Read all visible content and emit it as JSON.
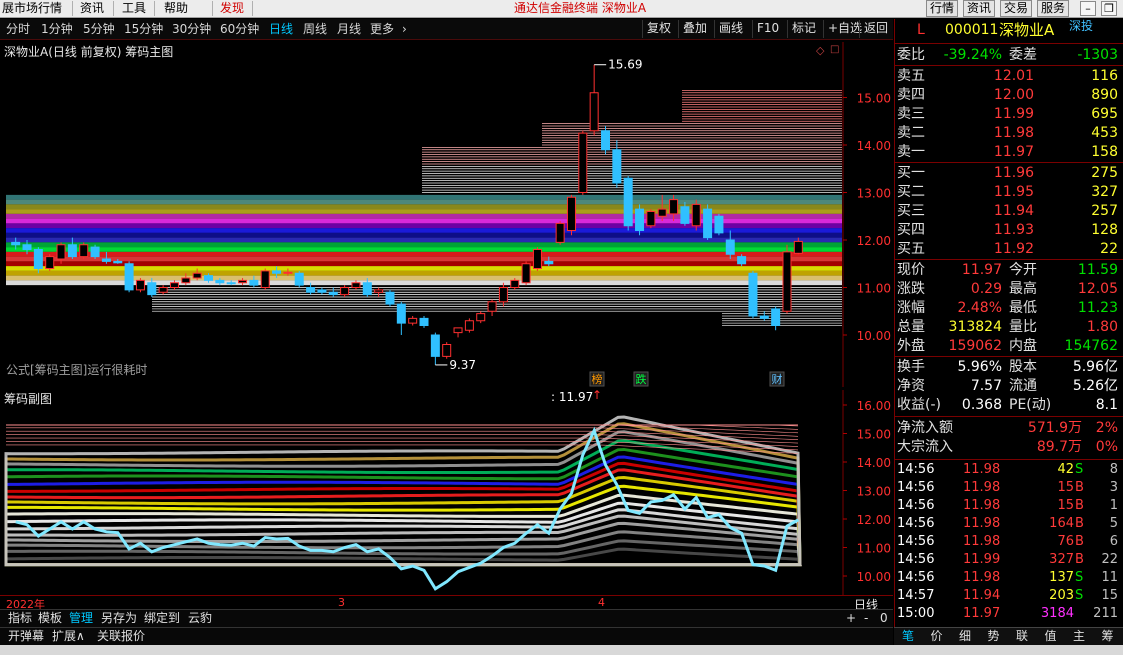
{
  "menu": {
    "items": [
      "展市场行情",
      "资讯",
      "工具",
      "帮助",
      "发现"
    ],
    "title": "通达信金融终端 深物业A",
    "right_buttons": [
      "行情",
      "资讯",
      "交易",
      "服务"
    ]
  },
  "toolbar": {
    "periods": [
      "分时",
      "1分钟",
      "5分钟",
      "15分钟",
      "30分钟",
      "60分钟",
      "日线",
      "周线",
      "月线",
      "更多"
    ],
    "active": "日线",
    "more_icon": "chevron-right-icon",
    "buttons": [
      "复权",
      "叠加",
      "画线",
      "F10",
      "标记",
      "+自选",
      "返回"
    ]
  },
  "main_chart": {
    "title": "深物业A(日线 前复权) 筹码主图",
    "note": "公式[筹码主图]运行很耗时",
    "max_label": "15.69",
    "min_label": "9.37",
    "y_labels": [
      "15.00",
      "14.00",
      "13.00",
      "12.00",
      "11.00",
      "10.00"
    ],
    "markers": [
      {
        "text": "榜",
        "color": "#ff9900"
      },
      {
        "text": "跌",
        "color": "#00ff40"
      },
      {
        "text": "财",
        "color": "#60c0ff"
      }
    ]
  },
  "sub_chart": {
    "title": "筹码副图",
    "cursor_value": ": 11.97",
    "y_labels": [
      "16.00",
      "15.00",
      "14.00",
      "13.00",
      "12.00",
      "11.00",
      "10.00"
    ]
  },
  "dates": [
    "2022年",
    "3",
    "4"
  ],
  "period_label": "日线",
  "tabs": [
    "指标",
    "模板",
    "管理",
    "另存为",
    "绑定到",
    "云豹"
  ],
  "tab_active": "管理",
  "zoom_controls": [
    "+",
    "-",
    "0"
  ],
  "bottom": [
    "开弹幕",
    "扩展∧",
    "关联报价"
  ],
  "chart_data": {
    "type": "candlestick",
    "y_range": [
      9.0,
      16.0
    ],
    "candles": [
      {
        "o": 11.95,
        "h": 12.05,
        "l": 11.8,
        "c": 11.9
      },
      {
        "o": 11.9,
        "h": 12.0,
        "l": 11.7,
        "c": 11.8
      },
      {
        "o": 11.8,
        "h": 11.85,
        "l": 11.3,
        "c": 11.4
      },
      {
        "o": 11.4,
        "h": 11.7,
        "l": 11.35,
        "c": 11.65
      },
      {
        "o": 11.6,
        "h": 11.95,
        "l": 11.5,
        "c": 11.9
      },
      {
        "o": 11.9,
        "h": 12.05,
        "l": 11.6,
        "c": 11.65
      },
      {
        "o": 11.65,
        "h": 11.95,
        "l": 11.6,
        "c": 11.9
      },
      {
        "o": 11.85,
        "h": 11.9,
        "l": 11.6,
        "c": 11.65
      },
      {
        "o": 11.6,
        "h": 11.75,
        "l": 11.5,
        "c": 11.55
      },
      {
        "o": 11.55,
        "h": 11.6,
        "l": 11.5,
        "c": 11.52
      },
      {
        "o": 11.5,
        "h": 11.55,
        "l": 10.9,
        "c": 10.95
      },
      {
        "o": 10.95,
        "h": 11.2,
        "l": 10.9,
        "c": 11.15
      },
      {
        "o": 11.1,
        "h": 11.2,
        "l": 10.8,
        "c": 10.85
      },
      {
        "o": 10.9,
        "h": 11.05,
        "l": 10.85,
        "c": 11.0
      },
      {
        "o": 11.0,
        "h": 11.15,
        "l": 10.95,
        "c": 11.1
      },
      {
        "o": 11.1,
        "h": 11.3,
        "l": 11.05,
        "c": 11.2
      },
      {
        "o": 11.2,
        "h": 11.4,
        "l": 11.15,
        "c": 11.3
      },
      {
        "o": 11.25,
        "h": 11.3,
        "l": 11.1,
        "c": 11.15
      },
      {
        "o": 11.15,
        "h": 11.2,
        "l": 11.05,
        "c": 11.1
      },
      {
        "o": 11.1,
        "h": 11.15,
        "l": 11.05,
        "c": 11.08
      },
      {
        "o": 11.1,
        "h": 11.2,
        "l": 11.05,
        "c": 11.15
      },
      {
        "o": 11.15,
        "h": 11.25,
        "l": 11.0,
        "c": 11.05
      },
      {
        "o": 11.0,
        "h": 11.4,
        "l": 10.95,
        "c": 11.35
      },
      {
        "o": 11.35,
        "h": 11.45,
        "l": 11.2,
        "c": 11.3
      },
      {
        "o": 11.3,
        "h": 11.4,
        "l": 11.25,
        "c": 11.32
      },
      {
        "o": 11.3,
        "h": 11.35,
        "l": 11.0,
        "c": 11.05
      },
      {
        "o": 11.0,
        "h": 11.1,
        "l": 10.85,
        "c": 10.9
      },
      {
        "o": 10.95,
        "h": 11.0,
        "l": 10.85,
        "c": 10.9
      },
      {
        "o": 10.9,
        "h": 11.0,
        "l": 10.8,
        "c": 10.85
      },
      {
        "o": 10.85,
        "h": 11.05,
        "l": 10.8,
        "c": 11.0
      },
      {
        "o": 11.0,
        "h": 11.15,
        "l": 10.95,
        "c": 11.1
      },
      {
        "o": 11.1,
        "h": 11.2,
        "l": 10.8,
        "c": 10.85
      },
      {
        "o": 10.9,
        "h": 11.0,
        "l": 10.8,
        "c": 10.95
      },
      {
        "o": 10.9,
        "h": 10.95,
        "l": 10.6,
        "c": 10.65
      },
      {
        "o": 10.65,
        "h": 10.7,
        "l": 10.0,
        "c": 10.25
      },
      {
        "o": 10.25,
        "h": 10.4,
        "l": 10.2,
        "c": 10.35
      },
      {
        "o": 10.35,
        "h": 10.4,
        "l": 10.15,
        "c": 10.2
      },
      {
        "o": 10.0,
        "h": 10.05,
        "l": 9.37,
        "c": 9.55
      },
      {
        "o": 9.55,
        "h": 9.85,
        "l": 9.5,
        "c": 9.8
      },
      {
        "o": 10.05,
        "h": 10.15,
        "l": 9.95,
        "c": 10.15
      },
      {
        "o": 10.1,
        "h": 10.35,
        "l": 10.05,
        "c": 10.3
      },
      {
        "o": 10.3,
        "h": 10.5,
        "l": 10.25,
        "c": 10.45
      },
      {
        "o": 10.5,
        "h": 10.75,
        "l": 10.4,
        "c": 10.7
      },
      {
        "o": 10.7,
        "h": 11.1,
        "l": 10.6,
        "c": 11.0
      },
      {
        "o": 11.0,
        "h": 11.2,
        "l": 10.95,
        "c": 11.15
      },
      {
        "o": 11.1,
        "h": 11.55,
        "l": 11.05,
        "c": 11.5
      },
      {
        "o": 11.4,
        "h": 11.85,
        "l": 11.35,
        "c": 11.8
      },
      {
        "o": 11.55,
        "h": 11.65,
        "l": 11.45,
        "c": 11.5
      },
      {
        "o": 11.95,
        "h": 12.4,
        "l": 11.9,
        "c": 12.35
      },
      {
        "o": 12.2,
        "h": 12.95,
        "l": 12.1,
        "c": 12.9
      },
      {
        "o": 13.0,
        "h": 14.3,
        "l": 12.95,
        "c": 14.25
      },
      {
        "o": 14.3,
        "h": 15.69,
        "l": 14.2,
        "c": 15.1
      },
      {
        "o": 14.3,
        "h": 14.4,
        "l": 13.8,
        "c": 13.9
      },
      {
        "o": 13.9,
        "h": 14.1,
        "l": 13.1,
        "c": 13.2
      },
      {
        "o": 13.3,
        "h": 13.35,
        "l": 12.2,
        "c": 12.3
      },
      {
        "o": 12.65,
        "h": 12.75,
        "l": 12.1,
        "c": 12.2
      },
      {
        "o": 12.3,
        "h": 12.65,
        "l": 12.25,
        "c": 12.6
      },
      {
        "o": 12.5,
        "h": 12.95,
        "l": 12.4,
        "c": 12.65
      },
      {
        "o": 12.55,
        "h": 12.95,
        "l": 12.4,
        "c": 12.85
      },
      {
        "o": 12.7,
        "h": 12.8,
        "l": 12.3,
        "c": 12.35
      },
      {
        "o": 12.3,
        "h": 12.85,
        "l": 12.2,
        "c": 12.75
      },
      {
        "o": 12.65,
        "h": 12.75,
        "l": 12.0,
        "c": 12.05
      },
      {
        "o": 12.5,
        "h": 12.55,
        "l": 12.1,
        "c": 12.15
      },
      {
        "o": 12.0,
        "h": 12.2,
        "l": 11.6,
        "c": 11.7
      },
      {
        "o": 11.65,
        "h": 11.7,
        "l": 11.45,
        "c": 11.5
      },
      {
        "o": 11.3,
        "h": 11.35,
        "l": 10.35,
        "c": 10.4
      },
      {
        "o": 10.4,
        "h": 10.5,
        "l": 10.3,
        "c": 10.35
      },
      {
        "o": 10.55,
        "h": 10.6,
        "l": 10.1,
        "c": 10.2
      },
      {
        "o": 10.5,
        "h": 11.9,
        "l": 10.45,
        "c": 11.75
      },
      {
        "o": 11.72,
        "h": 12.05,
        "l": 11.7,
        "c": 11.97
      }
    ]
  },
  "quote": {
    "badge": "L",
    "code": "000011",
    "name": "深物业A",
    "market": "深投",
    "weibi": {
      "label": "委比",
      "value": "-39.24%",
      "label2": "委差",
      "value2": "-1303"
    },
    "asks": [
      {
        "label": "卖五",
        "price": "12.01",
        "vol": "116"
      },
      {
        "label": "卖四",
        "price": "12.00",
        "vol": "890"
      },
      {
        "label": "卖三",
        "price": "11.99",
        "vol": "695"
      },
      {
        "label": "卖二",
        "price": "11.98",
        "vol": "453"
      },
      {
        "label": "卖一",
        "price": "11.97",
        "vol": "158"
      }
    ],
    "bids": [
      {
        "label": "买一",
        "price": "11.96",
        "vol": "275"
      },
      {
        "label": "买二",
        "price": "11.95",
        "vol": "327"
      },
      {
        "label": "买三",
        "price": "11.94",
        "vol": "257"
      },
      {
        "label": "买四",
        "price": "11.93",
        "vol": "128"
      },
      {
        "label": "买五",
        "price": "11.92",
        "vol": "22"
      }
    ],
    "stats": [
      {
        "l1": "现价",
        "v1": "11.97",
        "c1": "#ff3a3a",
        "l2": "今开",
        "v2": "11.59",
        "c2": "#00e000"
      },
      {
        "l1": "涨跌",
        "v1": "0.29",
        "c1": "#ff3a3a",
        "l2": "最高",
        "v2": "12.05",
        "c2": "#ff3a3a"
      },
      {
        "l1": "涨幅",
        "v1": "2.48%",
        "c1": "#ff3a3a",
        "l2": "最低",
        "v2": "11.23",
        "c2": "#00e000"
      },
      {
        "l1": "总量",
        "v1": "313824",
        "c1": "#ffff30",
        "l2": "量比",
        "v2": "1.80",
        "c2": "#ff3a3a"
      },
      {
        "l1": "外盘",
        "v1": "159062",
        "c1": "#ff3a3a",
        "l2": "内盘",
        "v2": "154762",
        "c2": "#00e000"
      }
    ],
    "fund": [
      {
        "l1": "换手",
        "v1": "5.96%",
        "l2": "股本",
        "v2": "5.96亿"
      },
      {
        "l1": "净资",
        "v1": "7.57",
        "l2": "流通",
        "v2": "5.26亿"
      },
      {
        "l1": "收益(-)",
        "v1": "0.368",
        "l2": "PE(动)",
        "v2": "8.1"
      }
    ],
    "flows": [
      {
        "label": "净流入额",
        "value": "571.9万",
        "pct": "2%"
      },
      {
        "label": "大宗流入",
        "value": "89.7万",
        "pct": "0%"
      }
    ],
    "ticks": [
      {
        "t": "14:56",
        "p": "11.98",
        "v": "42",
        "s": "S",
        "n": "8"
      },
      {
        "t": "14:56",
        "p": "11.98",
        "v": "15",
        "s": "B",
        "n": "3"
      },
      {
        "t": "14:56",
        "p": "11.98",
        "v": "15",
        "s": "B",
        "n": "1"
      },
      {
        "t": "14:56",
        "p": "11.98",
        "v": "164",
        "s": "B",
        "n": "5"
      },
      {
        "t": "14:56",
        "p": "11.98",
        "v": "76",
        "s": "B",
        "n": "6"
      },
      {
        "t": "14:56",
        "p": "11.99",
        "v": "327",
        "s": "B",
        "n": "22"
      },
      {
        "t": "14:56",
        "p": "11.98",
        "v": "137",
        "s": "S",
        "n": "11"
      },
      {
        "t": "14:57",
        "p": "11.94",
        "v": "203",
        "s": "S",
        "n": "15"
      },
      {
        "t": "15:00",
        "p": "11.97",
        "v": "3184",
        "s": "",
        "n": "211"
      }
    ],
    "tabs": [
      "笔",
      "价",
      "细",
      "势",
      "联",
      "值",
      "主",
      "筹"
    ]
  }
}
